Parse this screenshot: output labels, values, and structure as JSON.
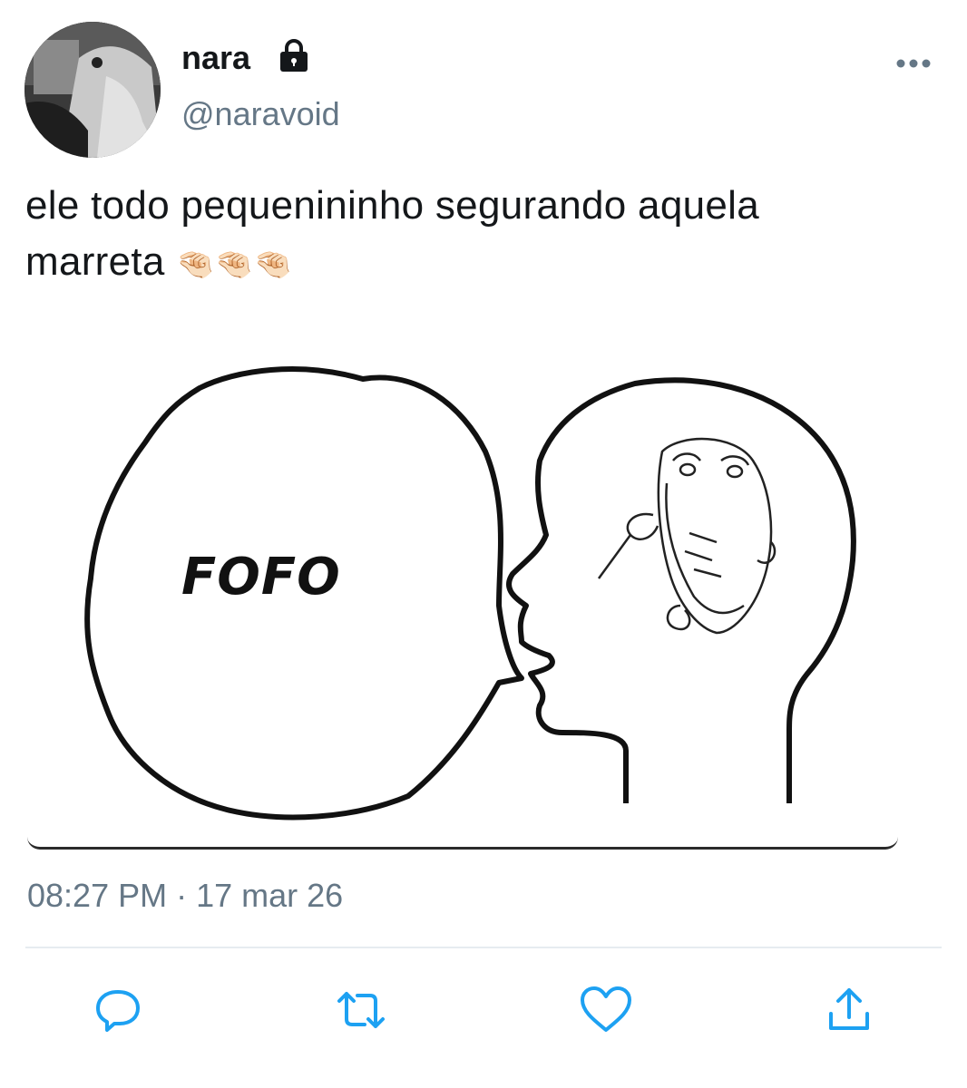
{
  "user": {
    "display_name": "nara",
    "handle": "@naravoid",
    "protected_icon": "lock-icon",
    "avatar_icon": "profile-photo"
  },
  "tweet": {
    "text_line1": "ele todo pequenininho segurando aquela",
    "text_line2": "marreta",
    "emojis": "🤏🏻🤏🏻🤏🏻",
    "timestamp": "08:27 PM · 17 mar 26"
  },
  "media": {
    "meme_text": "FOFO"
  },
  "actions": {
    "reply_icon": "reply-icon",
    "retweet_icon": "retweet-icon",
    "like_icon": "heart-icon",
    "share_icon": "share-icon"
  },
  "colors": {
    "text": "#14171a",
    "secondary": "#657786",
    "icon": "#1da1f2",
    "divider": "#e6ecf0"
  }
}
